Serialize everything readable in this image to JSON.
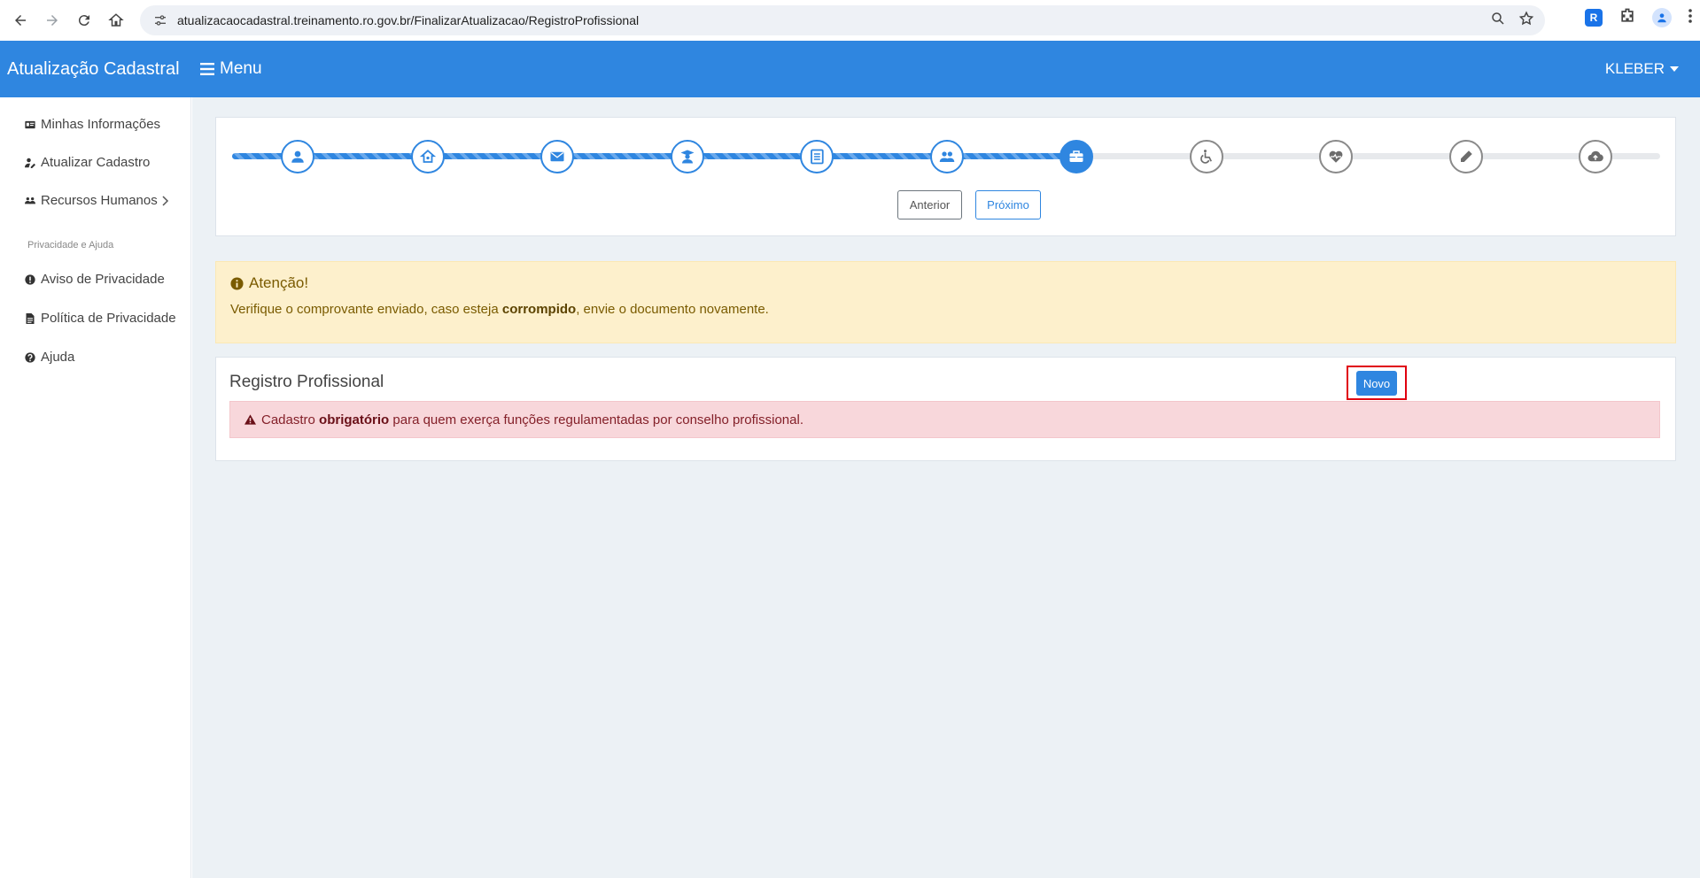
{
  "browser": {
    "url": "atualizacaocadastral.treinamento.ro.gov.br/FinalizarAtualizacao/RegistroProfissional",
    "extension_label": "R"
  },
  "header": {
    "brand": "Atualização Cadastral",
    "menu_label": "Menu",
    "user": "KLEBER",
    "color": "#2f86e0"
  },
  "sidebar": {
    "items": [
      {
        "label": "Minhas Informações",
        "icon": "id-card-icon"
      },
      {
        "label": "Atualizar Cadastro",
        "icon": "user-edit-icon"
      },
      {
        "label": "Recursos Humanos",
        "icon": "users-icon"
      }
    ],
    "section_title": "Privacidade e Ajuda",
    "help_items": [
      {
        "label": "Aviso de Privacidade",
        "icon": "exclamation-circle-icon"
      },
      {
        "label": "Política de Privacidade",
        "icon": "file-icon"
      },
      {
        "label": "Ajuda",
        "icon": "question-circle-icon"
      }
    ]
  },
  "stepper": {
    "steps": [
      {
        "icon": "user-icon",
        "state": "done"
      },
      {
        "icon": "home-icon",
        "state": "done"
      },
      {
        "icon": "envelope-icon",
        "state": "done"
      },
      {
        "icon": "graduate-icon",
        "state": "done"
      },
      {
        "icon": "document-icon",
        "state": "done"
      },
      {
        "icon": "users-icon",
        "state": "done"
      },
      {
        "icon": "briefcase-icon",
        "state": "active"
      },
      {
        "icon": "wheelchair-icon",
        "state": "todo"
      },
      {
        "icon": "heartbeat-icon",
        "state": "todo"
      },
      {
        "icon": "pen-icon",
        "state": "todo"
      },
      {
        "icon": "cloud-upload-icon",
        "state": "todo"
      }
    ],
    "progress_fraction": 0.6,
    "prev_label": "Anterior",
    "next_label": "Próximo"
  },
  "warning": {
    "title": "Atenção!",
    "msg_before": "Verifique o comprovante enviado, caso esteja ",
    "msg_bold": "corrompido",
    "msg_after": ", envie o documento novamente."
  },
  "registro": {
    "title": "Registro Profissional",
    "new_button": "Novo",
    "alert_before": "Cadastro ",
    "alert_bold": "obrigatório",
    "alert_after": " para quem exerça funções regulamentadas por conselho profissional."
  }
}
